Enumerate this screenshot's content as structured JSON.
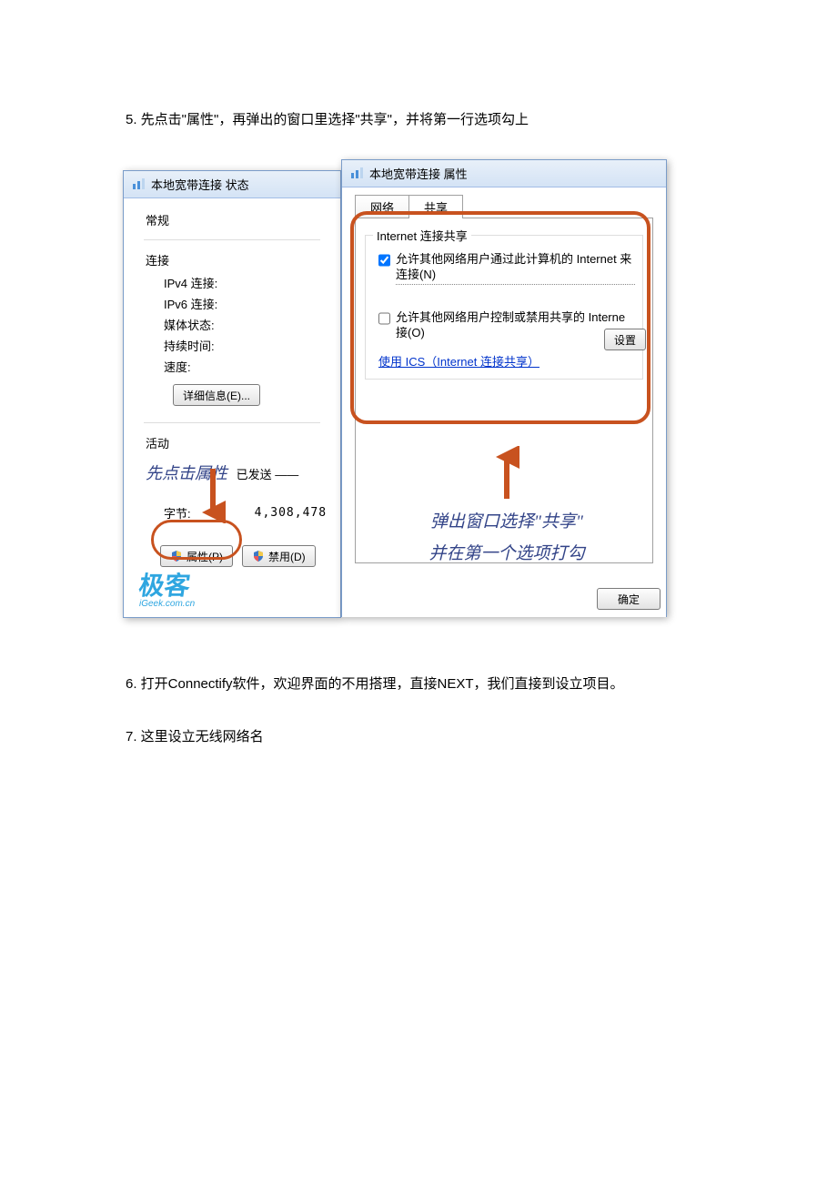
{
  "doc": {
    "step5": "5. 先点击\"属性\"，再弹出的窗口里选择\"共享\"，并将第一行选项勾上",
    "step6": "6. 打开Connectify软件，欢迎界面的不用搭理，直接NEXT，我们直接到设立项目。",
    "step7": "7. 这里设立无线网络名"
  },
  "status_window": {
    "title": "本地宽带连接 状态",
    "tab_general": "常规",
    "connection_label": "连接",
    "ipv4": "IPv4 连接:",
    "ipv6": "IPv6 连接:",
    "media": "媒体状态:",
    "duration": "持续时间:",
    "speed": "速度:",
    "details_btn": "详细信息(E)...",
    "activity_label": "活动",
    "sent_label": "已发送 ——",
    "bytes_label": "字节:",
    "bytes_value": "4,308,478",
    "properties_btn": "属性(P)",
    "disable_btn": "禁用(D)"
  },
  "props_window": {
    "title": "本地宽带连接 属性",
    "tab_network": "网络",
    "tab_sharing": "共享",
    "group_title": "Internet 连接共享",
    "check1": "允许其他网络用户通过此计算机的 Internet 来连接(N)",
    "check2": "允许其他网络用户控制或禁用共享的 Interne 接(O)",
    "link_ics": "使用 ICS（Internet 连接共享）",
    "settings_btn": "设置",
    "ok_btn": "确定"
  },
  "annotation": {
    "left": "先点击属性",
    "right_line1": "弹出窗口选择\"共享\"",
    "right_line2": "并在第一个选项打勾"
  },
  "watermark": {
    "text": "极客",
    "sub": "iGeek.com.cn"
  }
}
